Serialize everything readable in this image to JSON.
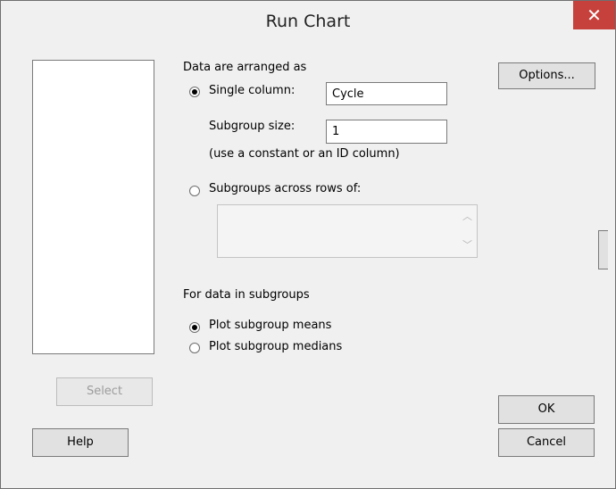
{
  "window": {
    "title": "Run Chart",
    "close_label": "✕"
  },
  "arrangement": {
    "heading": "Data are arranged as",
    "single_column_label": "Single column:",
    "single_column_value": "Cycle",
    "subgroup_size_label": "Subgroup size:",
    "subgroup_size_value": "1",
    "hint": "(use a constant or an ID column)",
    "across_rows_label": "Subgroups across rows of:",
    "selected": "single_column"
  },
  "subgroups": {
    "heading": "For data in subgroups",
    "means_label": "Plot subgroup means",
    "medians_label": "Plot subgroup medians",
    "selected": "means"
  },
  "buttons": {
    "options": "Options...",
    "select": "Select",
    "help": "Help",
    "ok": "OK",
    "cancel": "Cancel"
  },
  "icons": {
    "up": "chevron-up-icon",
    "down": "chevron-down-icon",
    "close": "close-icon"
  }
}
